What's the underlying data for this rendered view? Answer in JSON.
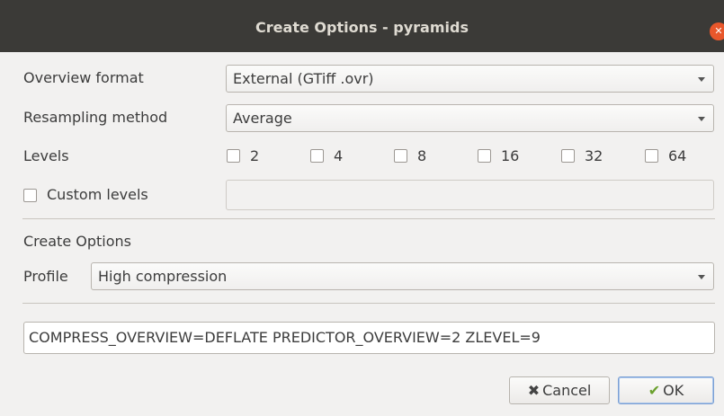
{
  "window": {
    "title": "Create Options - pyramids"
  },
  "overview_format": {
    "label": "Overview format",
    "value": "External (GTiff .ovr)"
  },
  "resampling": {
    "label": "Resampling method",
    "value": "Average"
  },
  "levels": {
    "label": "Levels",
    "items": [
      {
        "label": "2",
        "checked": false
      },
      {
        "label": "4",
        "checked": false
      },
      {
        "label": "8",
        "checked": false
      },
      {
        "label": "16",
        "checked": false
      },
      {
        "label": "32",
        "checked": false
      },
      {
        "label": "64",
        "checked": false
      }
    ]
  },
  "custom_levels": {
    "label": "Custom levels",
    "checked": false,
    "value": ""
  },
  "create_options": {
    "heading": "Create Options",
    "profile_label": "Profile",
    "profile_value": "High compression",
    "options_text": "COMPRESS_OVERVIEW=DEFLATE PREDICTOR_OVERVIEW=2 ZLEVEL=9"
  },
  "buttons": {
    "cancel": {
      "label": "Cancel",
      "icon": "x-icon"
    },
    "ok": {
      "label": "OK",
      "icon": "checkmark-icon"
    }
  }
}
